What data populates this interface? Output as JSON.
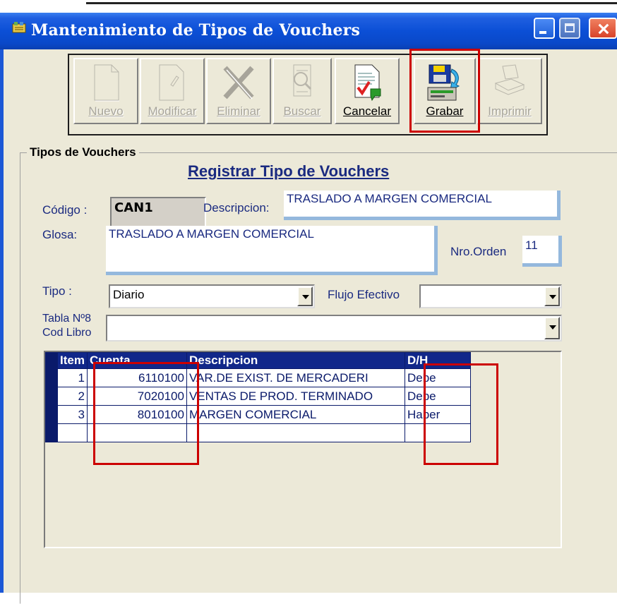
{
  "window": {
    "title": "Mantenimiento de Tipos de Vouchers"
  },
  "toolbar": {
    "nuevo": "Nuevo",
    "modificar": "Modificar",
    "eliminar": "Eliminar",
    "buscar": "Buscar",
    "cancelar": "Cancelar",
    "grabar": "Grabar",
    "imprimir": "Imprimir"
  },
  "group": {
    "title": "Tipos de Vouchers"
  },
  "form": {
    "title": "Registrar Tipo de Vouchers",
    "codigo_label": "Código :",
    "codigo_value": "CAN1",
    "descripcion_label": "Descripcion:",
    "descripcion_value": "TRASLADO A MARGEN COMERCIAL",
    "glosa_label": "Glosa:",
    "glosa_value": "TRASLADO A MARGEN COMERCIAL",
    "nro_orden_label": "Nro.Orden",
    "nro_orden_value": "11",
    "tipo_label": "Tipo :",
    "tipo_value": "Diario",
    "flujo_label": "Flujo Efectivo",
    "flujo_value": "",
    "tabla_label_line1": "Tabla Nº8",
    "tabla_label_line2": "Cod Libro",
    "tabla_value": ""
  },
  "grid": {
    "headers": [
      "Item",
      "Cuenta",
      "Descripcion",
      "D/H"
    ],
    "rows": [
      {
        "item": "1",
        "cuenta": "6110100",
        "descripcion": "VAR.DE EXIST. DE MERCADERI",
        "dh": "Debe"
      },
      {
        "item": "2",
        "cuenta": "7020100",
        "descripcion": "VENTAS DE PROD. TERMINADO",
        "dh": "Debe"
      },
      {
        "item": "3",
        "cuenta": "8010100",
        "descripcion": "MARGEN COMERCIAL",
        "dh": "Haber"
      },
      {
        "item": "",
        "cuenta": "",
        "descripcion": "",
        "dh": ""
      }
    ]
  },
  "colors": {
    "titlebar": "#0b4fd6",
    "grid_header": "#11278a",
    "highlight": "#cc0000",
    "window_bg": "#ece9d8"
  }
}
